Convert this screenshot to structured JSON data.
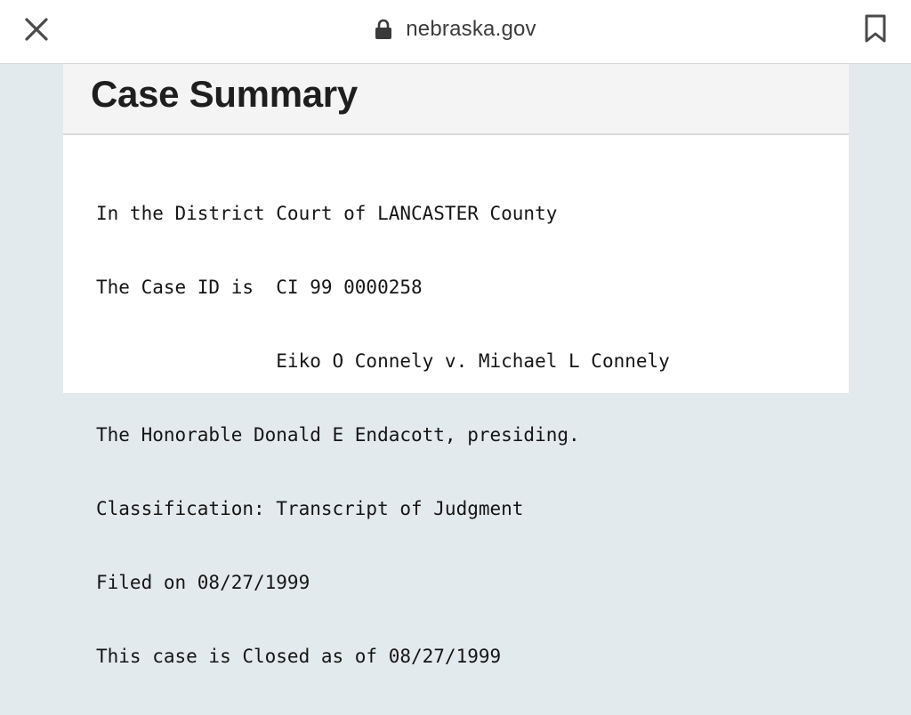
{
  "browser": {
    "close_icon": "close-icon",
    "lock_icon": "lock-icon",
    "url": "nebraska.gov",
    "bookmark_icon": "bookmark-icon"
  },
  "page": {
    "title": "Case Summary",
    "lines": [
      "In the District Court of LANCASTER County",
      "The Case ID is  CI 99 0000258",
      "                Eiko O Connely v. Michael L Connely",
      "The Honorable Donald E Endacott, presiding.",
      "Classification: Transcript of Judgment",
      "Filed on 08/27/1999",
      "This case is Closed as of 08/27/1999"
    ]
  },
  "colors": {
    "page_background": "#e3eaed",
    "header_background": "#f4f4f4"
  }
}
